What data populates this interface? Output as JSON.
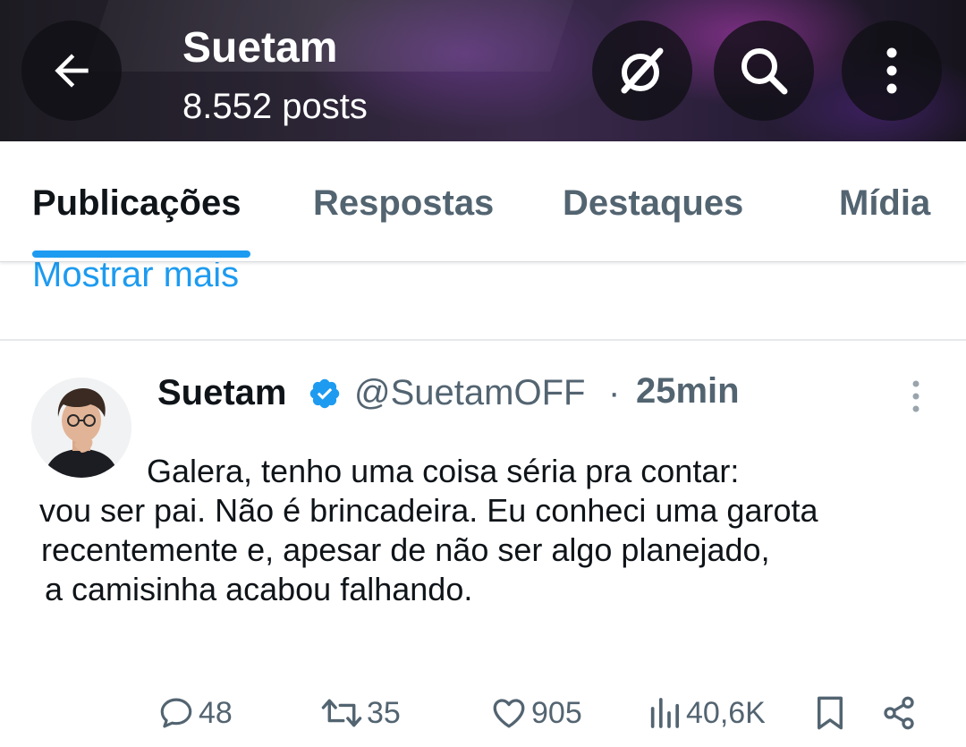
{
  "header": {
    "title": "Suetam",
    "post_count": "8.552 posts",
    "back_icon": "arrow-left-icon",
    "actions": [
      "grok-icon",
      "search-icon",
      "more-vertical-icon"
    ]
  },
  "tabs": [
    {
      "label": "Publicações",
      "active": true
    },
    {
      "label": "Respostas",
      "active": false
    },
    {
      "label": "Destaques",
      "active": false
    },
    {
      "label": "Mídia",
      "active": false
    }
  ],
  "show_more": "Mostrar mais",
  "post": {
    "author_name": "Suetam",
    "verified": true,
    "handle": "@SuetamOFF",
    "separator": "·",
    "time": "25min",
    "text_lines": [
      "Galera, tenho uma coisa séria pra contar:",
      "vou ser pai. Não é brincadeira. Eu conheci uma garota",
      "recentemente e, apesar de não ser algo planejado,",
      "a camisinha acabou falhando."
    ],
    "stats": {
      "replies": "48",
      "reposts": "35",
      "likes": "905",
      "views": "40,6K"
    }
  },
  "colors": {
    "accent": "#1d9bf0",
    "text_primary": "#0f1419",
    "text_secondary": "#536471"
  }
}
